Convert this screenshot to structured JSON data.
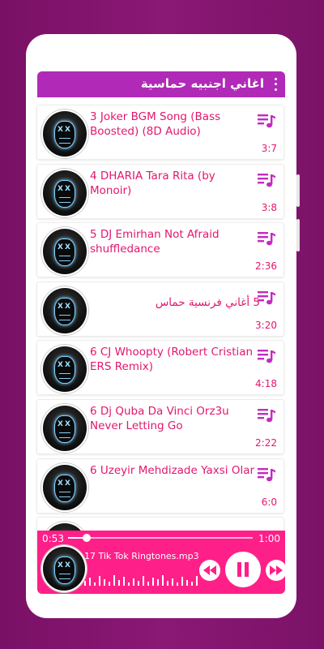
{
  "appbar": {
    "title": "اغاني اجنبيه حماسية",
    "menu_icon": "more-vert-icon"
  },
  "colors": {
    "accent": "#e2176e",
    "appbar": "#b02ab7",
    "player": "#ff1f88",
    "background": "#7a1066"
  },
  "songs": [
    {
      "title": "3 Joker BGM Song (Bass Boosted) (8D Audio)",
      "duration": "3:7",
      "rtl": false
    },
    {
      "title": "4 DHARIA   Tara Rita (by Monoir)",
      "duration": "3:8",
      "rtl": false
    },
    {
      "title": "5 DJ Emirhan   Not Afraid shuffledance",
      "duration": "2:36",
      "rtl": false
    },
    {
      "title": "5 أغاني فرنسية حماس",
      "duration": "3:20",
      "rtl": true
    },
    {
      "title": "6 CJ   Whoopty (Robert Cristian ERS Remix)",
      "duration": "4:18",
      "rtl": false
    },
    {
      "title": "6 Dj Quba  Da Vinci  Orz3u   Never Letting Go",
      "duration": "2:22",
      "rtl": false
    },
    {
      "title": "6 Uzeyir Mehdizade   Yaxsi Olar",
      "duration": "6:0",
      "rtl": false
    }
  ],
  "player": {
    "elapsed": "0:53",
    "total": "1:00",
    "progress_fraction": 0.1,
    "track": "17  Tik Tok Ringtones.mp3",
    "prev_icon": "rewind-icon",
    "play_icon": "pause-icon",
    "next_icon": "fast-forward-icon"
  }
}
